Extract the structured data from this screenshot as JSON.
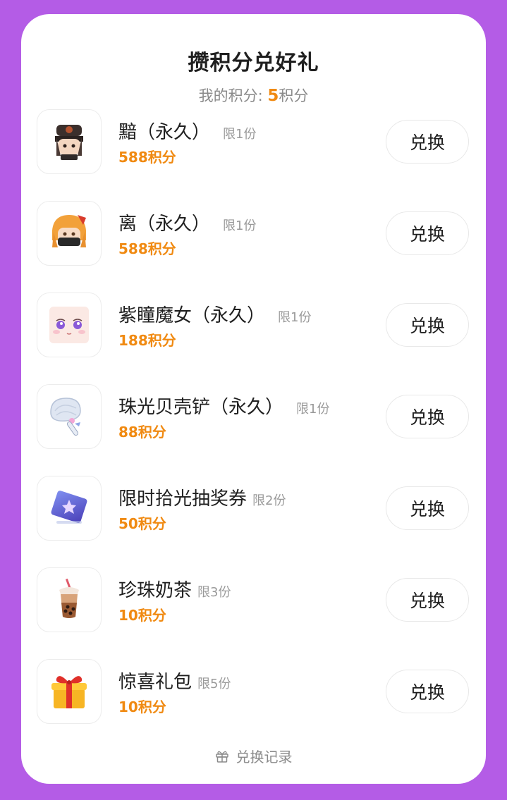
{
  "header": {
    "title": "攒积分兑好礼",
    "points_label": "我的积分: ",
    "points_value": "5",
    "points_unit": "积分"
  },
  "items": [
    {
      "name": "黯（永久）",
      "limit": "限1份",
      "cost": "588积分",
      "button": "兑换",
      "icon": "dark-hat-character-icon"
    },
    {
      "name": "离（永久）",
      "limit": "限1份",
      "cost": "588积分",
      "button": "兑换",
      "icon": "orange-hair-masked-character-icon"
    },
    {
      "name": "紫瞳魔女（永久）",
      "limit": "限1份",
      "cost": "188积分",
      "button": "兑换",
      "icon": "purple-eyed-face-icon"
    },
    {
      "name": "珠光贝壳铲（永久）",
      "limit": "限1份",
      "cost": "88积分",
      "button": "兑换",
      "icon": "pearl-shell-shovel-icon"
    },
    {
      "name": "限时拾光抽奖券",
      "limit": "限2份",
      "cost": "50积分",
      "button": "兑换",
      "icon": "lottery-ticket-icon"
    },
    {
      "name": "珍珠奶茶",
      "limit": "限3份",
      "cost": "10积分",
      "button": "兑换",
      "icon": "bubble-tea-icon"
    },
    {
      "name": "惊喜礼包",
      "limit": "限5份",
      "cost": "10积分",
      "button": "兑换",
      "icon": "gift-box-icon"
    }
  ],
  "footer": {
    "history_label": "兑换记录",
    "history_icon": "gift-outline-icon"
  },
  "colors": {
    "background": "#b45ce6",
    "accent": "#f08a12"
  }
}
